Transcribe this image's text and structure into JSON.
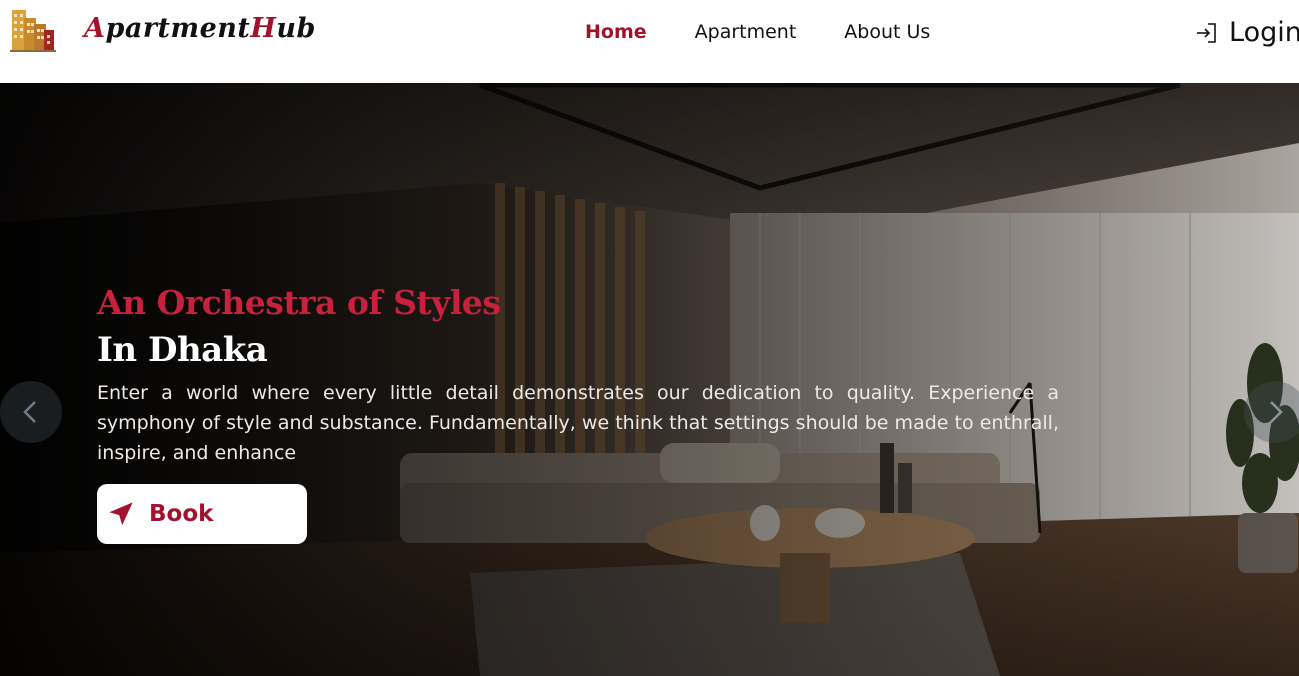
{
  "brand": {
    "part1_initial": "A",
    "part1_rest": "partment",
    "part2_initial": "H",
    "part2_rest": "ub",
    "logo_icon": "building-logo-icon",
    "accent_color": "#a3122d"
  },
  "nav": {
    "items": [
      {
        "label": "Home",
        "active": true
      },
      {
        "label": "Apartment",
        "active": false
      },
      {
        "label": "About Us",
        "active": false
      }
    ],
    "login_label": "Login",
    "login_icon": "login-arrow-icon"
  },
  "hero": {
    "eyebrow": "An Orchestra of Styles",
    "headline": "In Dhaka",
    "description": "Enter a world where every little detail demonstrates our dedication to quality. Experience a symphony of style and substance. Fundamentally, we think that settings should be made to enthrall, inspire, and enhance",
    "button_label": "Book",
    "button_icon": "location-arrow-icon",
    "prev_icon": "chevron-left-icon",
    "next_icon": "chevron-right-icon"
  }
}
